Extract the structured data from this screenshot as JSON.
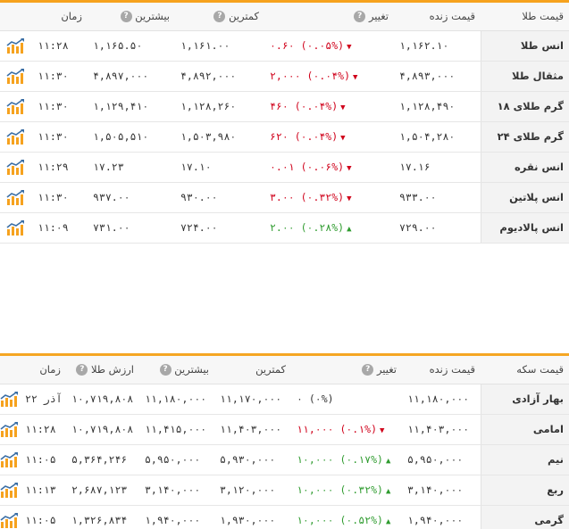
{
  "gold": {
    "headers": {
      "name": "قیمت طلا",
      "live": "قیمت زنده",
      "change": "تغییر",
      "low": "کمترین",
      "high": "بیشترین",
      "time": "زمان"
    },
    "rows": [
      {
        "name": "انس طلا",
        "live": "۱,۱۶۲.۱۰",
        "dir": "down",
        "change": "۰.۶۰ (۰.۰۵%)",
        "low": "۱,۱۶۱.۰۰",
        "high": "۱,۱۶۵.۵۰",
        "time": "۱۱:۲۸"
      },
      {
        "name": "مثقال طلا",
        "live": "۴,۸۹۳,۰۰۰",
        "dir": "down",
        "change": "۲,۰۰۰ (۰.۰۴%)",
        "low": "۴,۸۹۲,۰۰۰",
        "high": "۴,۸۹۷,۰۰۰",
        "time": "۱۱:۳۰"
      },
      {
        "name": "گرم طلای ۱۸",
        "live": "۱,۱۲۸,۴۹۰",
        "dir": "down",
        "change": "۴۶۰ (۰.۰۴%)",
        "low": "۱,۱۲۸,۲۶۰",
        "high": "۱,۱۲۹,۴۱۰",
        "time": "۱۱:۳۰"
      },
      {
        "name": "گرم طلای ۲۴",
        "live": "۱,۵۰۴,۲۸۰",
        "dir": "down",
        "change": "۶۲۰ (۰.۰۴%)",
        "low": "۱,۵۰۳,۹۸۰",
        "high": "۱,۵۰۵,۵۱۰",
        "time": "۱۱:۳۰"
      },
      {
        "name": "انس نقره",
        "live": "۱۷.۱۶",
        "dir": "down",
        "change": "۰.۰۱ (۰.۰۶%)",
        "low": "۱۷.۱۰",
        "high": "۱۷.۲۳",
        "time": "۱۱:۲۹"
      },
      {
        "name": "انس پلاتین",
        "live": "۹۳۳.۰۰",
        "dir": "down",
        "change": "۳.۰۰ (۰.۳۲%)",
        "low": "۹۳۰.۰۰",
        "high": "۹۳۷.۰۰",
        "time": "۱۱:۳۰"
      },
      {
        "name": "انس پالادیوم",
        "live": "۷۲۹.۰۰",
        "dir": "up",
        "change": "۲.۰۰ (۰.۲۸%)",
        "low": "۷۲۴.۰۰",
        "high": "۷۳۱.۰۰",
        "time": "۱۱:۰۹"
      }
    ]
  },
  "coin": {
    "headers": {
      "name": "قیمت سکه",
      "live": "قیمت زنده",
      "change": "تغییر",
      "low": "کمترین",
      "high": "بیشترین",
      "value": "ارزش طلا",
      "time": "زمان"
    },
    "rows": [
      {
        "name": "بهار آزادی",
        "live": "۱۱,۱۸۰,۰۰۰",
        "dir": "flat",
        "change": "۰ (۰%)",
        "low": "۱۱,۱۷۰,۰۰۰",
        "high": "۱۱,۱۸۰,۰۰۰",
        "value": "۱۰,۷۱۹,۸۰۸",
        "time": "۲۲ آذر"
      },
      {
        "name": "امامی",
        "live": "۱۱,۴۰۳,۰۰۰",
        "dir": "down",
        "change": "۱۱,۰۰۰ (۰.۱%)",
        "low": "۱۱,۴۰۳,۰۰۰",
        "high": "۱۱,۴۱۵,۰۰۰",
        "value": "۱۰,۷۱۹,۸۰۸",
        "time": "۱۱:۲۸"
      },
      {
        "name": "نیم",
        "live": "۵,۹۵۰,۰۰۰",
        "dir": "up",
        "change": "۱۰,۰۰۰ (۰.۱۷%)",
        "low": "۵,۹۳۰,۰۰۰",
        "high": "۵,۹۵۰,۰۰۰",
        "value": "۵,۳۶۴,۲۴۶",
        "time": "۱۱:۰۵"
      },
      {
        "name": "ربع",
        "live": "۳,۱۴۰,۰۰۰",
        "dir": "up",
        "change": "۱۰,۰۰۰ (۰.۳۲%)",
        "low": "۳,۱۲۰,۰۰۰",
        "high": "۳,۱۴۰,۰۰۰",
        "value": "۲,۶۸۷,۱۲۳",
        "time": "۱۱:۱۳"
      },
      {
        "name": "گرمی",
        "live": "۱,۹۴۰,۰۰۰",
        "dir": "up",
        "change": "۱۰,۰۰۰ (۰.۵۲%)",
        "low": "۱,۹۳۰,۰۰۰",
        "high": "۱,۹۴۰,۰۰۰",
        "value": "۱,۳۲۶,۸۳۴",
        "time": "۱۱:۰۵"
      }
    ]
  },
  "icons": {
    "info": "question-icon",
    "chart": "chart-icon",
    "down": "triangle-down-icon",
    "up": "triangle-up-icon"
  },
  "colors": {
    "accent": "#f6a21e",
    "down": "#d0021b",
    "up": "#2e9b2e"
  }
}
